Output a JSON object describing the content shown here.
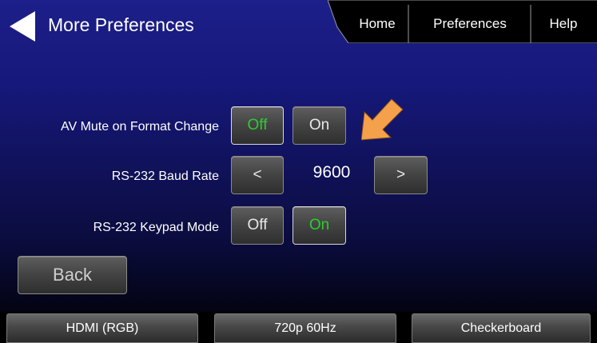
{
  "header": {
    "title": "More Preferences",
    "back_icon": "back-triangle-icon"
  },
  "tabs": [
    {
      "label": "Home"
    },
    {
      "label": "Preferences"
    },
    {
      "label": "Help"
    }
  ],
  "settings": {
    "av_mute": {
      "label": "AV Mute on Format Change",
      "off_label": "Off",
      "on_label": "On",
      "selected": "Off"
    },
    "baud_rate": {
      "label": "RS-232 Baud Rate",
      "decrement_label": "<",
      "increment_label": ">",
      "value": "9600"
    },
    "keypad_mode": {
      "label": "RS-232 Keypad Mode",
      "off_label": "Off",
      "on_label": "On",
      "selected": "On"
    }
  },
  "back_button": {
    "label": "Back"
  },
  "status_bar": {
    "interface": "HDMI (RGB)",
    "format": "720p 60Hz",
    "pattern": "Checkerboard"
  },
  "colors": {
    "selected_text": "#2ecc2e",
    "pointer_arrow": "#f5a04a"
  }
}
